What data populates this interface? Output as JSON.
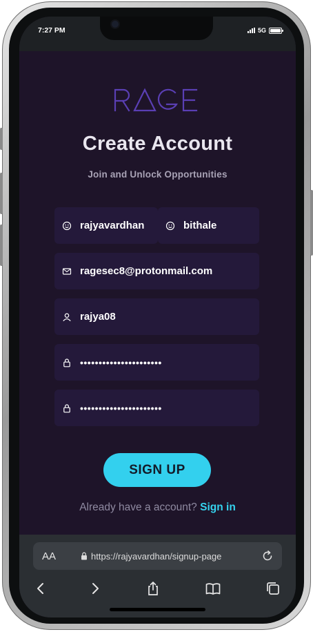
{
  "status": {
    "time": "7:27 PM",
    "network": "5G"
  },
  "brand": {
    "logo_text": "RAGE",
    "accent": "#5a3fb4"
  },
  "header": {
    "title": "Create Account",
    "subtitle": "Join and Unlock Opportunities"
  },
  "form": {
    "first_name": {
      "value": "rajyavardhan",
      "icon": "smile-icon"
    },
    "last_name": {
      "value": "bithale",
      "icon": "smile-icon"
    },
    "email": {
      "value": "ragesec8@protonmail.com",
      "icon": "mail-icon"
    },
    "username": {
      "value": "rajya08",
      "icon": "user-icon"
    },
    "password": {
      "value": "••••••••••••••••••••••",
      "icon": "lock-icon"
    },
    "confirm_password": {
      "value": "••••••••••••••••••••••",
      "icon": "lock-icon"
    },
    "submit_label": "SIGN UP"
  },
  "signin": {
    "prompt": "Already have a account?",
    "link": "Sign in"
  },
  "browser": {
    "aa_label": "AA",
    "url": "https://rajyavardhan/signup-page"
  },
  "colors": {
    "background": "#1e1429",
    "field_bg": "#24193a",
    "button": "#33d0ee",
    "link": "#35d3ee"
  }
}
